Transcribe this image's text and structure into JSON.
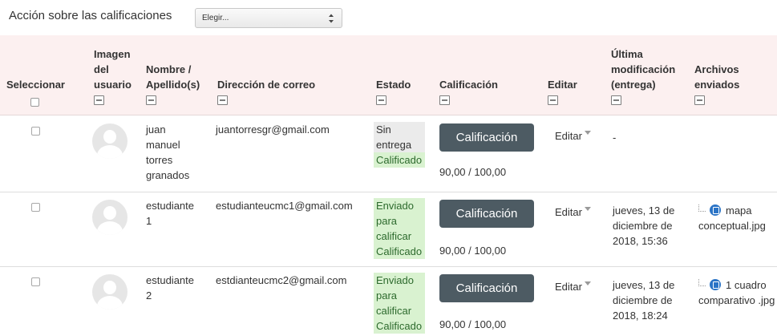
{
  "toolbar": {
    "action_label": "Acción sobre las calificaciones",
    "select_value": "Elegir..."
  },
  "columns": {
    "select": "Seleccionar",
    "image": [
      "Imagen",
      "del",
      "usuario"
    ],
    "name": [
      "Nombre /",
      "Apellido(s)"
    ],
    "email": "Dirección de correo",
    "status": "Estado",
    "grade": "Calificación",
    "edit": "Editar",
    "modified": [
      "Última",
      "modificación",
      "(entrega)"
    ],
    "files": [
      "Archivos",
      "enviados"
    ]
  },
  "rows": [
    {
      "name": [
        "juan",
        "manuel",
        "torres",
        "granados"
      ],
      "email": "juantorresgr@gmail.com",
      "status": [
        "Sin",
        "entrega"
      ],
      "status_grade": "Calificado",
      "grade_button": "Calificación",
      "grade_value": "90,00 / 100,00",
      "edit": "Editar",
      "modified": [
        "-"
      ],
      "file": ""
    },
    {
      "name": [
        "estudiante",
        "1"
      ],
      "email": "estudianteucmc1@gmail.com",
      "status": [
        "Enviado",
        "para",
        "calificar"
      ],
      "status_grade": "Calificado",
      "grade_button": "Calificación",
      "grade_value": "90,00 / 100,00",
      "edit": "Editar",
      "modified": [
        "jueves, 13 de",
        "diciembre de",
        "2018, 15:36"
      ],
      "file": "mapa conceptual.jpg"
    },
    {
      "name": [
        "estudiante",
        "2"
      ],
      "email": "estdianteucmc2@gmail.com",
      "status": [
        "Enviado",
        "para",
        "calificar"
      ],
      "status_grade": "Calificado",
      "grade_button": "Calificación",
      "grade_value": "90,00 / 100,00",
      "edit": "Editar",
      "modified": [
        "jueves, 13 de",
        "diciembre de",
        "2018, 18:24"
      ],
      "file": "1 cuadro comparativo .jpg"
    }
  ],
  "icons": {
    "collapse": "collapse-column-icon",
    "file": "file-icon",
    "avatar": "default-user-avatar",
    "caret": "dropdown-caret-icon"
  },
  "colors": {
    "header_bg": "#fcf0f0",
    "button_bg": "#4d5b63",
    "status_green": "#d9f2d0",
    "status_gray": "#ebebeb",
    "file_icon": "#2b74c6"
  }
}
